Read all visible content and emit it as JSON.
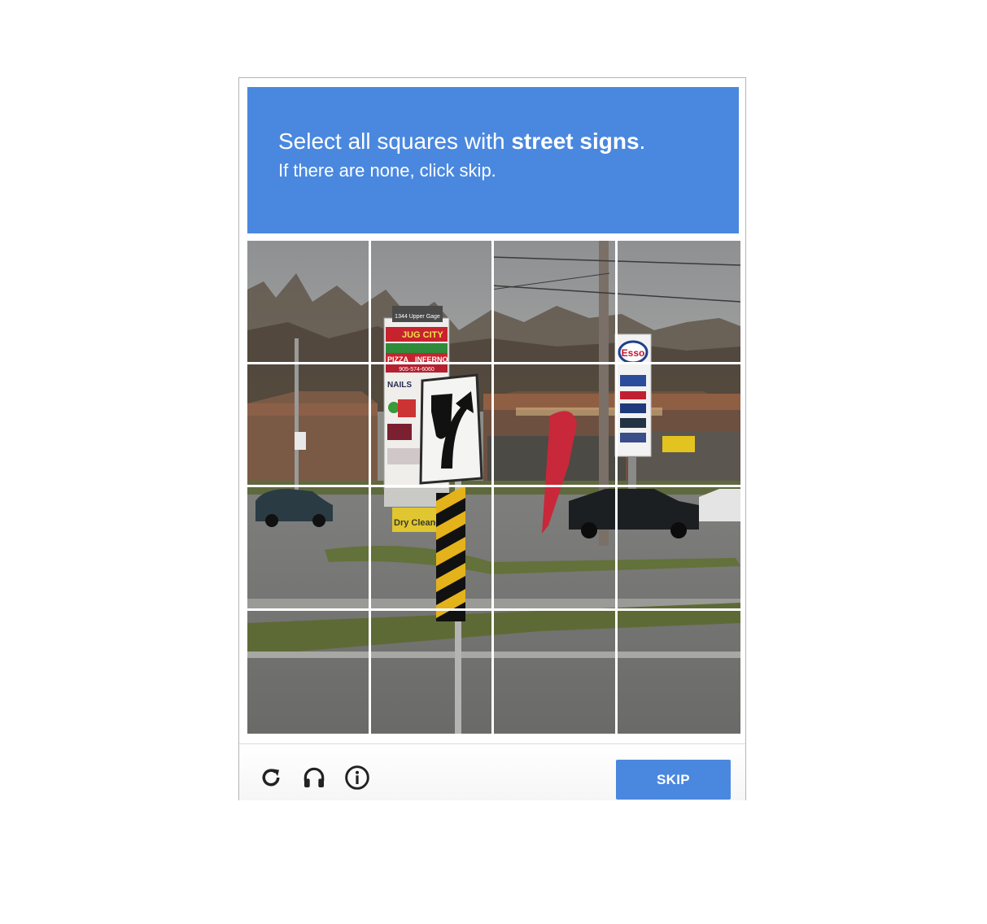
{
  "header": {
    "instruction_prefix": "Select all squares with ",
    "target": "street signs",
    "instruction_suffix": ".",
    "subtext": "If there are none, click skip."
  },
  "grid": {
    "rows": 4,
    "columns": 4,
    "image_texts": {
      "plaza_sign_top": "1344 Upper Gage",
      "plaza_sign_1": "JUG CITY",
      "plaza_sign_2": "PIZZA",
      "plaza_sign_3": "INFERNO",
      "plaza_sign_phone": "905-574-6060",
      "plaza_sign_4": "NAILS",
      "gas_sign": "Esso",
      "dry_cleaners": "Dry Cleaners"
    }
  },
  "footer": {
    "reload_icon": "reload-icon",
    "audio_icon": "headphones-icon",
    "info_icon": "info-icon",
    "skip_label": "SKIP"
  },
  "colors": {
    "accent": "#4a88df",
    "grid_lines": "#ffffff"
  }
}
